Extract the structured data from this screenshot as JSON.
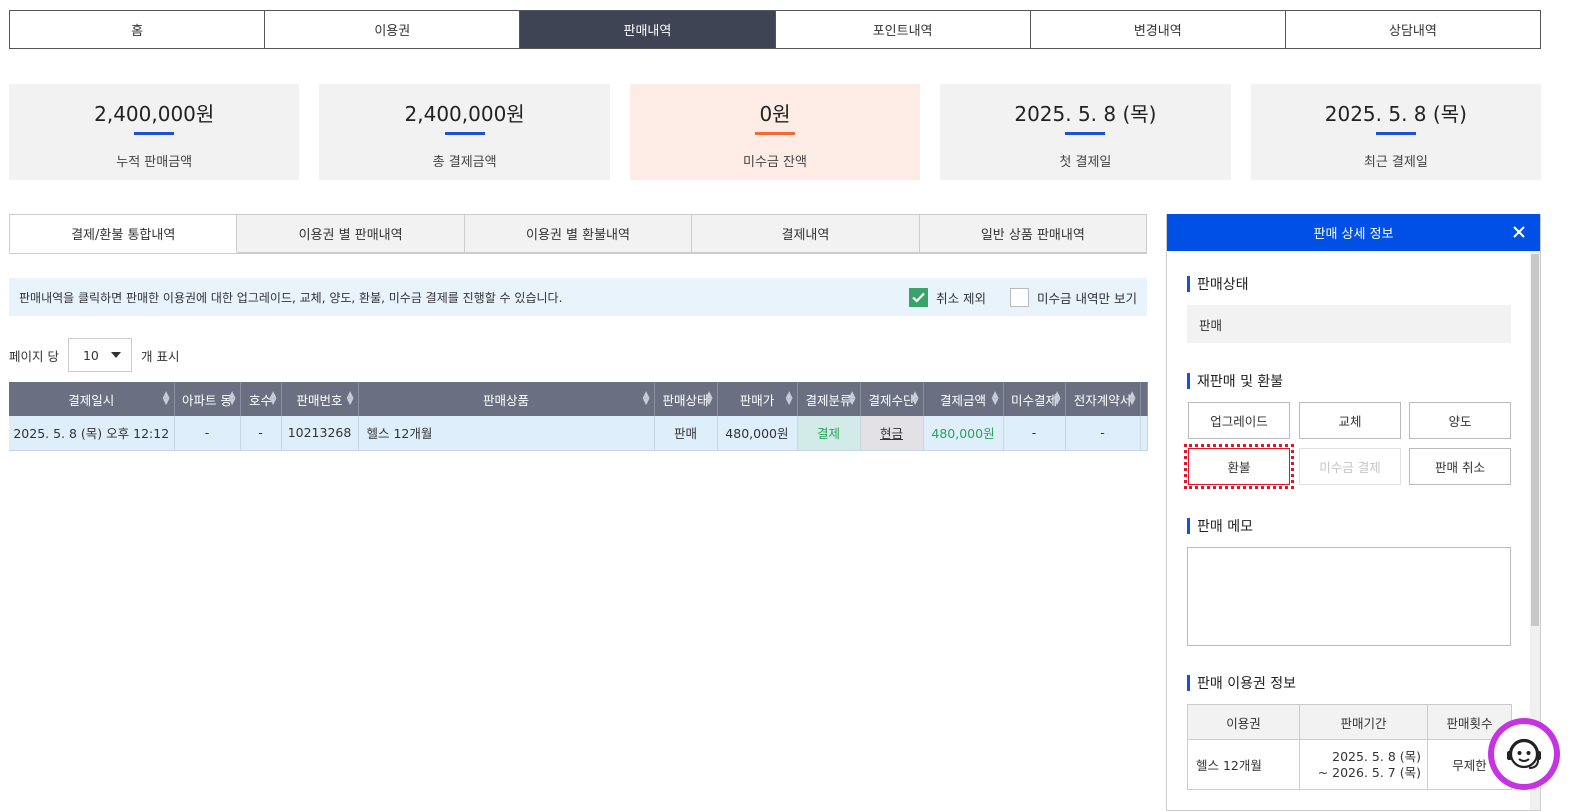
{
  "nav": [
    "홈",
    "이용권",
    "판매내역",
    "포인트내역",
    "변경내역",
    "상담내역"
  ],
  "cards": [
    {
      "value": "2,400,000원",
      "label": "누적 판매금액"
    },
    {
      "value": "2,400,000원",
      "label": "총 결제금액"
    },
    {
      "value": "0원",
      "label": "미수금 잔액"
    },
    {
      "value": "2025. 5. 8 (목)",
      "label": "첫 결제일"
    },
    {
      "value": "2025. 5. 8 (목)",
      "label": "최근 결제일"
    }
  ],
  "subtabs": [
    "결제/환불 통합내역",
    "이용권 별 판매내역",
    "이용권 별 환불내역",
    "결제내역",
    "일반 상품 판매내역"
  ],
  "info": {
    "message": "판매내역을 클릭하면 판매한 이용권에 대한 업그레이드, 교체, 양도, 환불, 미수금 결제를 진행할 수 있습니다.",
    "exclude_cancel": "취소 제외",
    "unpaid_only": "미수금 내역만 보기"
  },
  "perpage": {
    "prefix": "페이지 당",
    "value": "10",
    "suffix": "개 표시"
  },
  "table": {
    "headers": [
      "결제일시",
      "아파트 동",
      "호수",
      "판매번호",
      "판매상품",
      "판매상태",
      "판매가",
      "결제분류",
      "결제수단",
      "결제금액",
      "미수결제",
      "전자계약서"
    ],
    "row": {
      "date": "2025. 5. 8 (목) 오후 12:12",
      "dong": "-",
      "ho": "-",
      "sale_no": "10213268",
      "product": "헬스 12개월",
      "status": "판매",
      "price": "480,000원",
      "pay_type": "결제",
      "method": "현금",
      "amount": "480,000원",
      "unpaid": "-",
      "contract": "-"
    }
  },
  "panel": {
    "title": "판매 상세 정보",
    "status_title": "판매상태",
    "status_value": "판매",
    "resale_title": "재판매 및 환불",
    "buttons": {
      "upgrade": "업그레이드",
      "exchange": "교체",
      "transfer": "양도",
      "refund": "환불",
      "unpaid_pay": "미수금 결제",
      "cancel_sale": "판매 취소"
    },
    "memo_title": "판매 메모",
    "ticket_title": "판매 이용권 정보",
    "ticket_headers": [
      "이용권",
      "판매기간",
      "판매횟수"
    ],
    "ticket_row": {
      "name": "헬스 12개월",
      "period_start": "2025. 5. 8 (목)",
      "period_end": "~ 2026. 5. 7 (목)",
      "count": "무제한"
    }
  },
  "colors": {
    "accent": "#0050e6",
    "nav_active": "#3f4455",
    "highlight": "#e0152a",
    "help": "#c534e0"
  }
}
